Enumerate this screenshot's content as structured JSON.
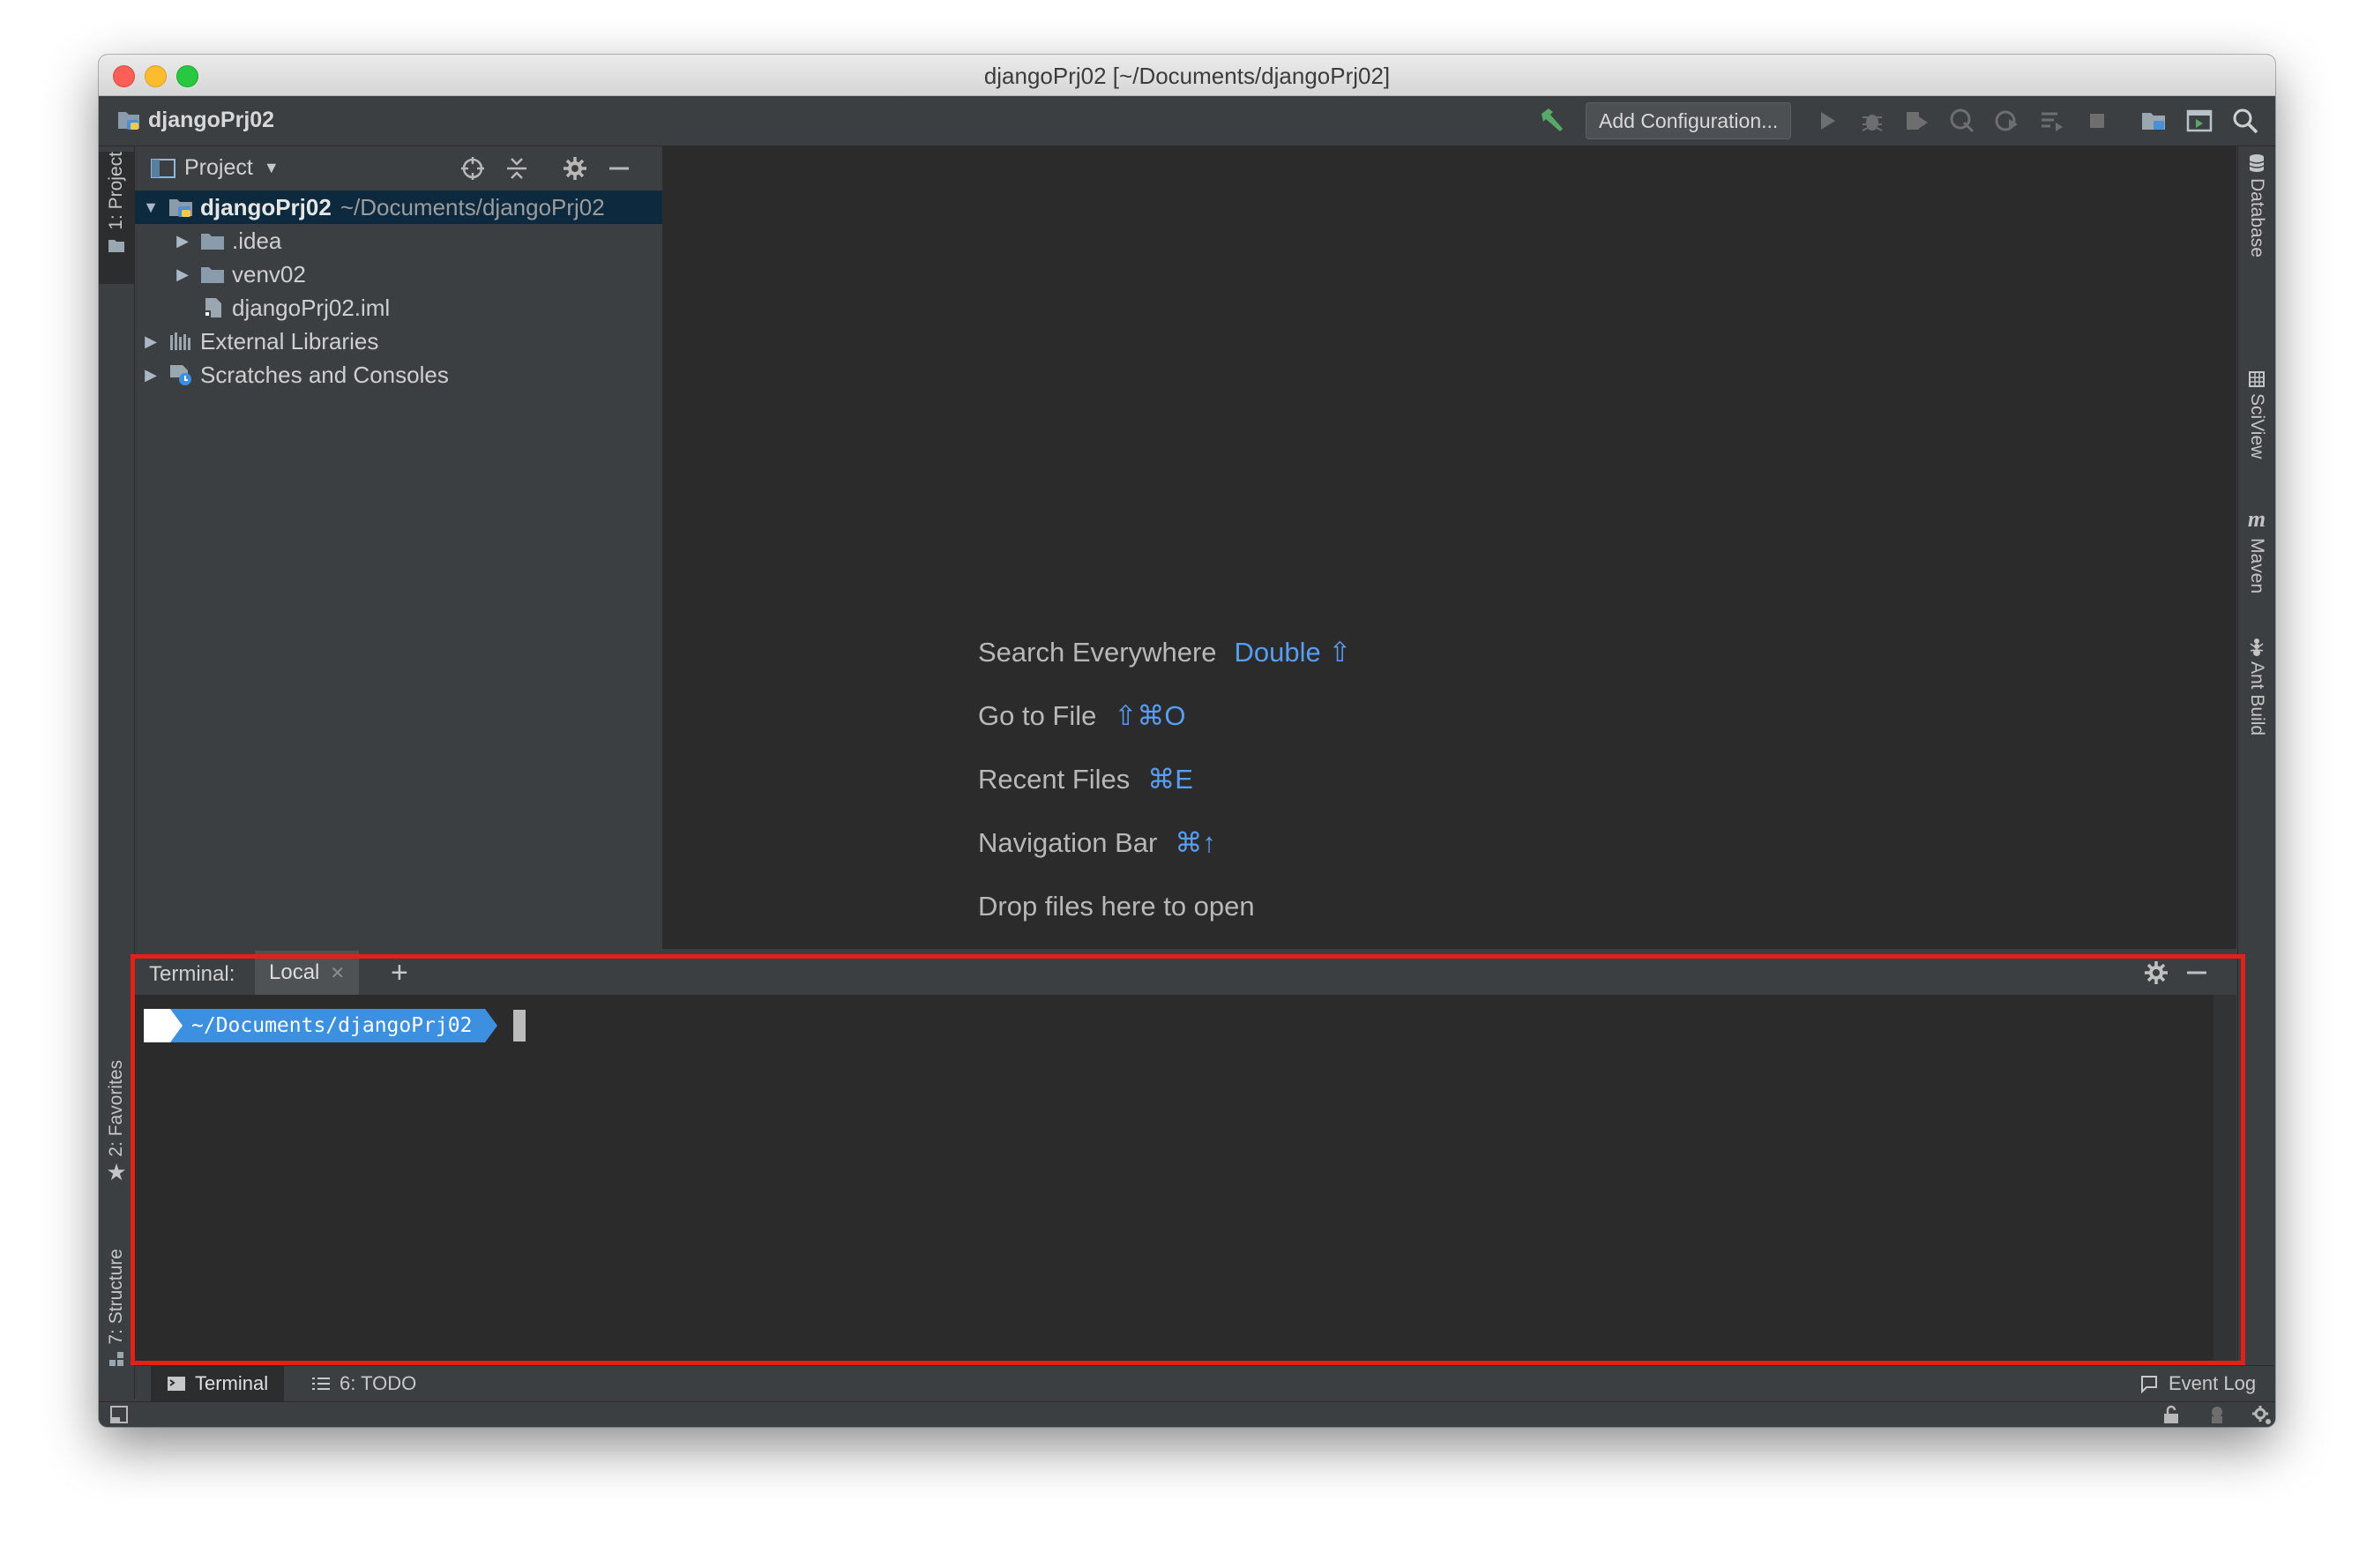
{
  "window": {
    "title": "djangoPrj02 [~/Documents/djangoPrj02]"
  },
  "navbar": {
    "project_name": "djangoPrj02",
    "add_configuration_label": "Add Configuration..."
  },
  "left_strip": {
    "project_tab": "1: Project",
    "favorites_tab": "2: Favorites",
    "structure_tab": "7: Structure"
  },
  "right_strip": {
    "database_tab": "Database",
    "sciview_tab": "SciView",
    "maven_tab": "Maven",
    "ant_tab": "Ant Build"
  },
  "project_panel": {
    "title": "Project",
    "tree": [
      {
        "label": "djangoPrj02",
        "path": "~/Documents/djangoPrj02"
      },
      {
        "label": ".idea"
      },
      {
        "label": "venv02"
      },
      {
        "label": "djangoPrj02.iml"
      },
      {
        "label": "External Libraries"
      },
      {
        "label": "Scratches and Consoles"
      }
    ]
  },
  "editor": {
    "hints": [
      {
        "text": "Search Everywhere",
        "key": "Double ⇧"
      },
      {
        "text": "Go to File",
        "key": "⇧⌘O"
      },
      {
        "text": "Recent Files",
        "key": "⌘E"
      },
      {
        "text": "Navigation Bar",
        "key": "⌘↑"
      },
      {
        "text": "Drop files here to open",
        "key": ""
      }
    ]
  },
  "terminal": {
    "label": "Terminal:",
    "tab_name": "Local",
    "prompt_path": "~/Documents/djangoPrj02"
  },
  "bottom_bar": {
    "terminal_tab": "Terminal",
    "todo_tab": "6: TODO",
    "event_log": "Event Log"
  },
  "colors": {
    "accent_blue": "#589df6",
    "selection": "#0d293e",
    "highlight_red": "#e32119",
    "prompt_blue": "#3d8fe0"
  }
}
